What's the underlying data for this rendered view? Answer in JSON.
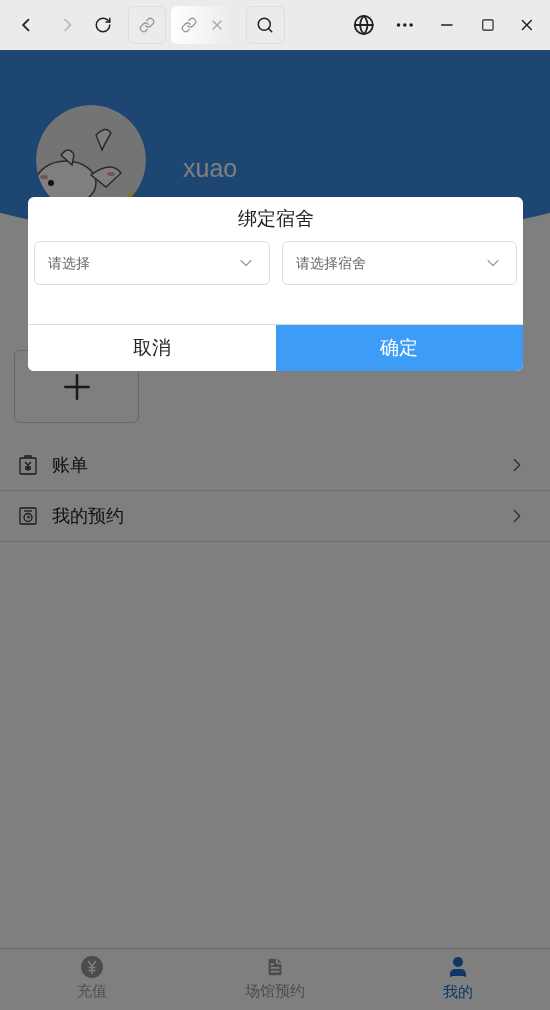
{
  "profile": {
    "username": "xuao"
  },
  "menu": [
    {
      "label": "账单",
      "kind": "bill"
    },
    {
      "label": "我的预约",
      "kind": "appointment"
    }
  ],
  "tab_bar": [
    {
      "label": "充值",
      "kind": "recharge",
      "selected": false
    },
    {
      "label": "场馆预约",
      "kind": "venue",
      "selected": false
    },
    {
      "label": "我的",
      "kind": "me",
      "selected": true
    }
  ],
  "dialog": {
    "title": "绑定宿舍",
    "selects": [
      {
        "placeholder": "请选择"
      },
      {
        "placeholder": "请选择宿舍"
      }
    ],
    "buttons": [
      {
        "label": "取消",
        "kind": "cancel"
      },
      {
        "label": "确定",
        "kind": "confirm"
      }
    ]
  }
}
